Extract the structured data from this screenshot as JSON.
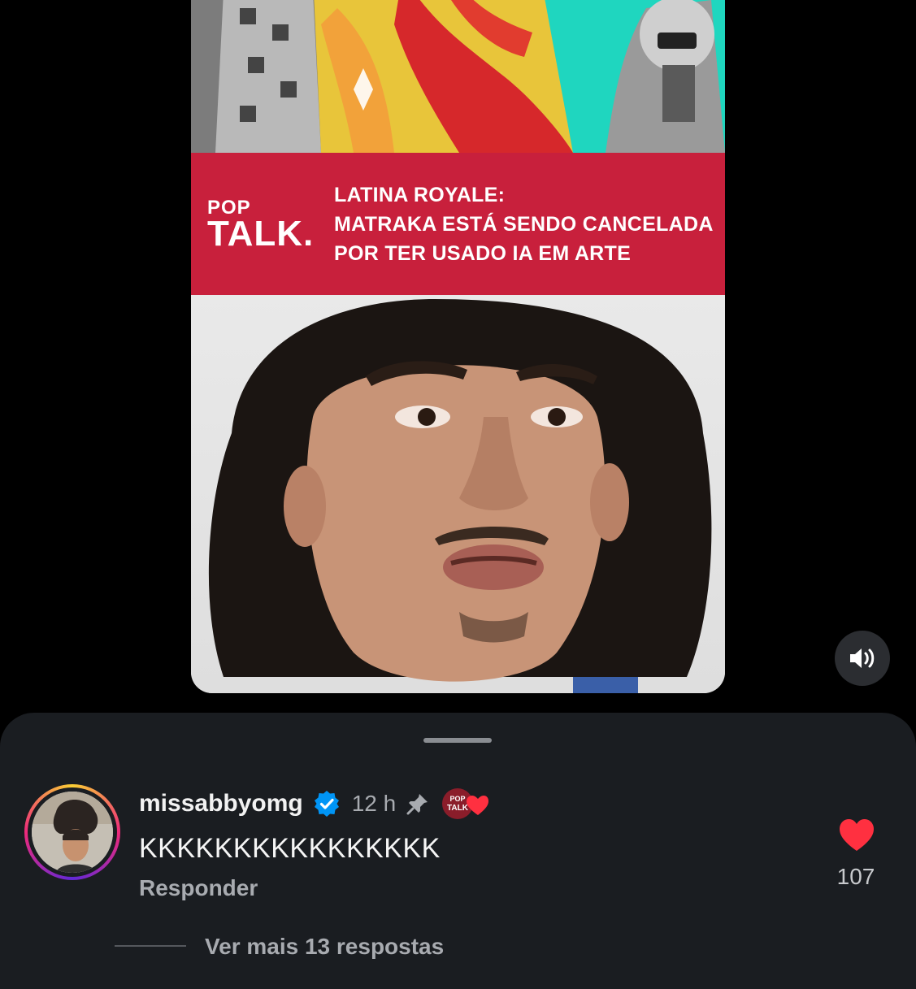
{
  "video": {
    "logo_top": "POP",
    "logo_bottom": "TALK.",
    "headline": [
      "LATINA ROYALE:",
      "MATRAKA ESTÁ SENDO CANCELADA",
      "POR TER USADO IA EM ARTE"
    ],
    "banner_color": "#c8203c",
    "sound_icon": "speaker-on-icon"
  },
  "comment": {
    "username": "missabbyomg",
    "time": "12 h",
    "text": "KKKKKKKKKKKKKKKK",
    "reply_label": "Responder",
    "like_count": "107",
    "more_replies": "Ver mais 13 respostas",
    "creator_badge_text": "POP TALK",
    "like_color": "#ff3040",
    "verified_color": "#0095f6"
  }
}
